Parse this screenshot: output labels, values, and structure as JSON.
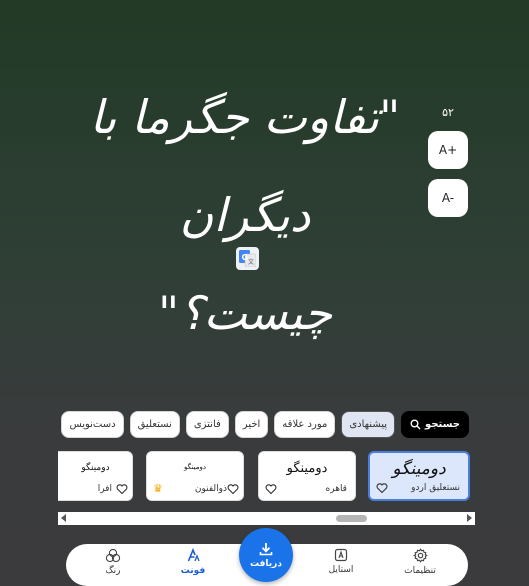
{
  "quote": {
    "line1": "\"تفاوت جگرما با دیگران",
    "line2": "چیست؟\""
  },
  "font_size": {
    "value": "۵۲",
    "increase_label": "A+",
    "decrease_label": "A-"
  },
  "translate": {
    "icon": "google-translate-icon"
  },
  "filters": [
    {
      "label": "جستجو",
      "type": "search"
    },
    {
      "label": "پیشنهادی",
      "active": true
    },
    {
      "label": "مورد علاقه"
    },
    {
      "label": "اخیر"
    },
    {
      "label": "فانتزی"
    },
    {
      "label": "نستعلیق"
    },
    {
      "label": "دست‌نویس"
    }
  ],
  "fonts": [
    {
      "sample": "دومینگو",
      "name": "نستعلیق اردو",
      "selected": true,
      "badge": "heart-icon"
    },
    {
      "sample": "دومینگو",
      "name": "قاهره",
      "selected": false,
      "badge": "heart-icon"
    },
    {
      "sample": "دومینگو",
      "name": "ذوالفنون",
      "selected": false,
      "badge": "heart-icon",
      "premium": true
    },
    {
      "sample": "دومینگو",
      "name": "افرا",
      "selected": false,
      "badge": "heart-icon"
    }
  ],
  "bottom_nav": {
    "settings": "تنظیمات",
    "style": "استایل",
    "download": "دریافت",
    "font": "فونت",
    "color": "رنگ"
  },
  "colors": {
    "accent": "#1a73e8",
    "selected_card": "#dde7fb"
  }
}
